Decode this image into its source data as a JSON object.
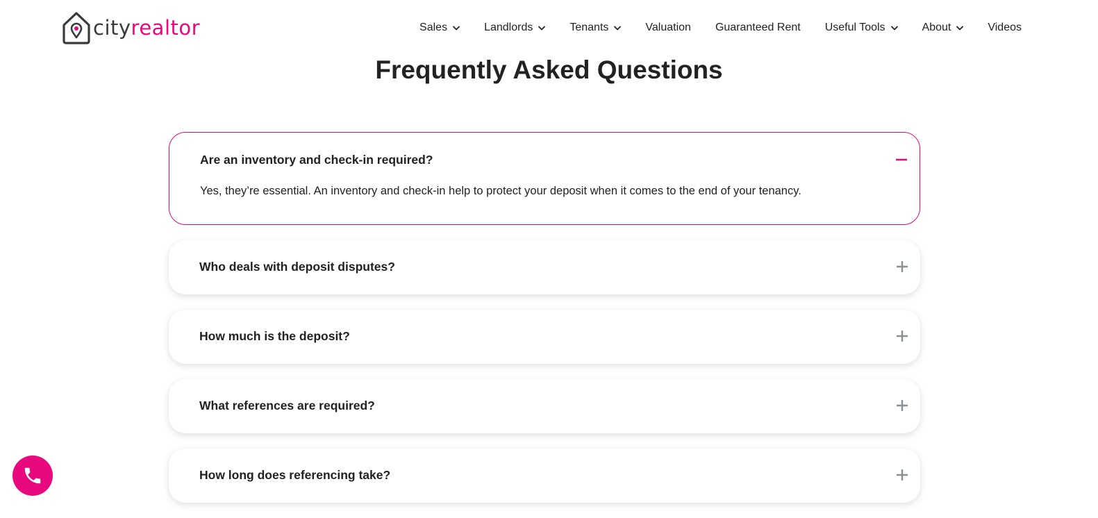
{
  "brand": {
    "name_part1": "city",
    "name_part2": "realtor",
    "accent_color": "#e8097f",
    "text_color": "#3a3a3a"
  },
  "nav": {
    "items": [
      {
        "label": "Sales",
        "has_dropdown": true
      },
      {
        "label": "Landlords",
        "has_dropdown": true
      },
      {
        "label": "Tenants",
        "has_dropdown": true
      },
      {
        "label": "Valuation",
        "has_dropdown": false
      },
      {
        "label": "Guaranteed Rent",
        "has_dropdown": false
      },
      {
        "label": "Useful Tools",
        "has_dropdown": true
      },
      {
        "label": "About",
        "has_dropdown": true
      },
      {
        "label": "Videos",
        "has_dropdown": false
      }
    ]
  },
  "page": {
    "title": "Frequently Asked Questions"
  },
  "faq": {
    "items": [
      {
        "question": "Are an inventory and check-in required?",
        "answer": "Yes, they’re essential. An inventory and check-in help to protect your deposit when it comes to the end of your tenancy.",
        "expanded": true,
        "icon": "minus-icon"
      },
      {
        "question": "Who deals with deposit disputes?",
        "expanded": false,
        "icon": "plus-icon"
      },
      {
        "question": "How much is the deposit?",
        "expanded": false,
        "icon": "plus-icon"
      },
      {
        "question": "What references are required?",
        "expanded": false,
        "icon": "plus-icon"
      },
      {
        "question": "How long does referencing take?",
        "expanded": false,
        "icon": "plus-icon"
      }
    ]
  },
  "floating": {
    "call_icon": "phone-icon",
    "color": "#e8097f"
  }
}
